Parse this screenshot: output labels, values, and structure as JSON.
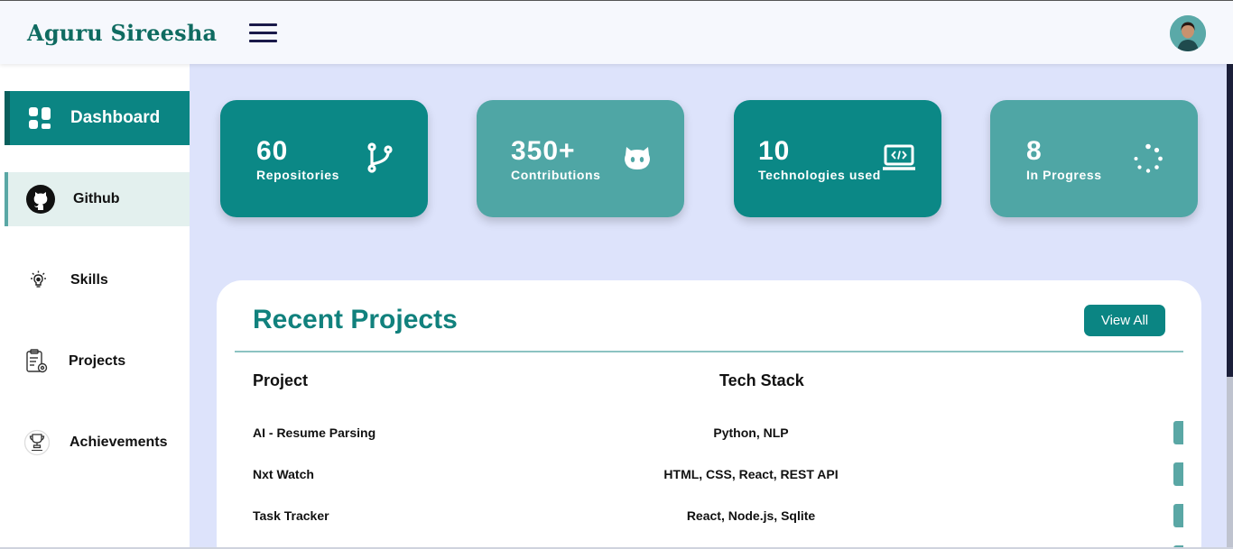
{
  "header": {
    "brand": "Aguru Sireesha"
  },
  "sidebar": {
    "items": [
      {
        "label": "Dashboard",
        "icon": "dashboard-icon",
        "state": "active"
      },
      {
        "label": "Github",
        "icon": "github-icon",
        "state": "highlight"
      },
      {
        "label": "Skills",
        "icon": "lightbulb-icon",
        "state": "normal"
      },
      {
        "label": "Projects",
        "icon": "clipboard-gear-icon",
        "state": "normal"
      },
      {
        "label": "Achievements",
        "icon": "trophy-icon",
        "state": "normal"
      }
    ]
  },
  "stats": [
    {
      "value": "60",
      "label": "Repositories",
      "icon": "git-branch-icon"
    },
    {
      "value": "350+",
      "label": "Contributions",
      "icon": "github-cat-icon"
    },
    {
      "value": "10",
      "label": "Technologies used",
      "icon": "code-laptop-icon"
    },
    {
      "value": "8",
      "label": "In Progress",
      "icon": "loading-spinner-icon"
    }
  ],
  "recent": {
    "title": "Recent Projects",
    "view_all": "View All",
    "columns": {
      "project": "Project",
      "tech": "Tech Stack"
    },
    "rows": [
      {
        "project": "AI - Resume Parsing",
        "tech": "Python, NLP"
      },
      {
        "project": "Nxt Watch",
        "tech": "HTML, CSS, React, REST API"
      },
      {
        "project": "Task Tracker",
        "tech": "React, Node.js, Sqlite"
      }
    ]
  },
  "colors": {
    "brand": "#0f6b61",
    "card_dark": "#0b8886",
    "card_light": "#4fa6a5",
    "page_bg": "#dde3fb",
    "accent": "#0b8583"
  }
}
